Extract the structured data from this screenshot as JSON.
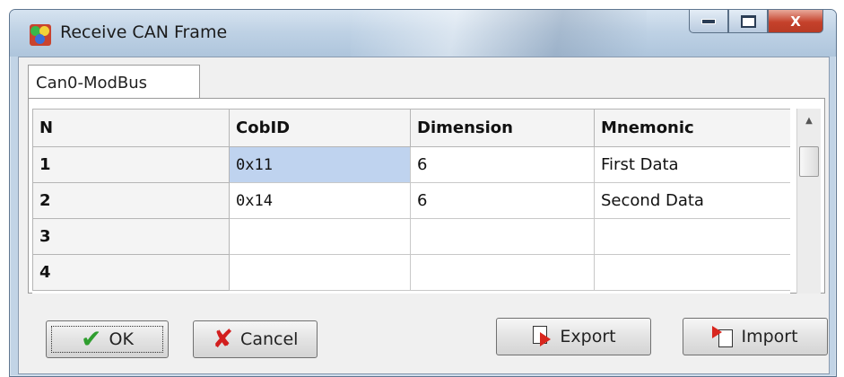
{
  "window": {
    "title": "Receive CAN Frame",
    "close_glyph": "X"
  },
  "tabs": [
    {
      "label": "Can0-ModBus",
      "active": true
    }
  ],
  "table": {
    "headers": [
      "N",
      "CobID",
      "Dimension",
      "Mnemonic"
    ],
    "rows": [
      {
        "n": "1",
        "cobid": "0x11",
        "dimension": "6",
        "mnemonic": "First Data",
        "selected_cell": "cobid"
      },
      {
        "n": "2",
        "cobid": "0x14",
        "dimension": "6",
        "mnemonic": "Second Data"
      },
      {
        "n": "3",
        "cobid": "",
        "dimension": "",
        "mnemonic": ""
      },
      {
        "n": "4",
        "cobid": "",
        "dimension": "",
        "mnemonic": ""
      }
    ]
  },
  "buttons": {
    "ok": "OK",
    "cancel": "Cancel",
    "export": "Export",
    "import": "Import"
  },
  "icons": {
    "app": "app-icon",
    "ok": "checkmark-icon",
    "cancel": "x-icon",
    "export": "export-icon",
    "import": "import-icon",
    "scroll_up": "scroll-up-arrow-icon"
  },
  "colors": {
    "selected_cell": "#bfd3ef",
    "close_button": "#c5412b",
    "ok_check": "#2f9e2f",
    "cancel_x": "#d21e1e"
  }
}
